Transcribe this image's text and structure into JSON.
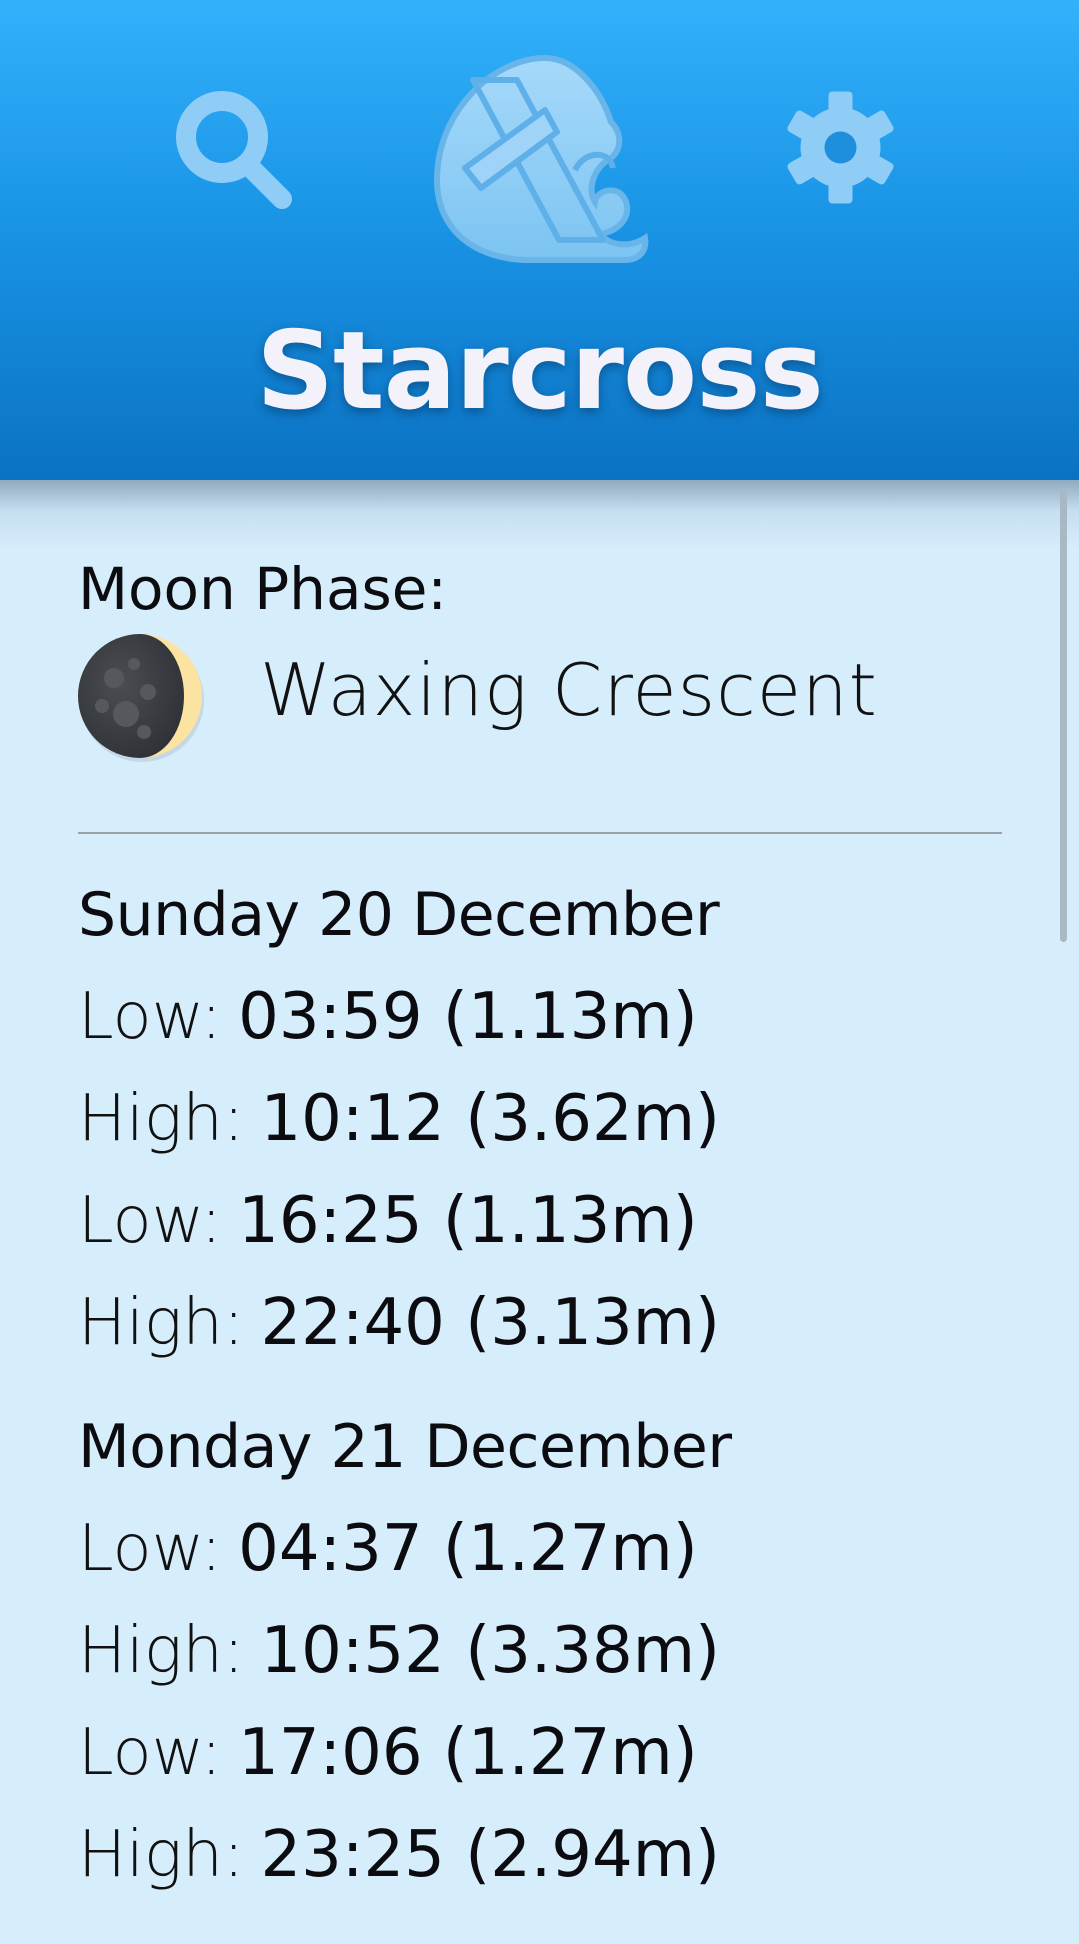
{
  "header": {
    "app_title": "Starcross",
    "search_icon": "search-icon",
    "settings_icon": "gear-icon",
    "logo": "app-logo",
    "colors": {
      "gradient_top": "#33b1fb",
      "gradient_bottom": "#0b72c2",
      "icon": "#8fcdf6",
      "title": "#f3f2fb"
    }
  },
  "moon": {
    "label": "Moon Phase:",
    "phase": "Waxing Crescent",
    "icon": "waxing-crescent-moon-icon"
  },
  "days": [
    {
      "heading": "Sunday 20 December",
      "tides": [
        {
          "type": "Low:",
          "value": "03:59 (1.13m)"
        },
        {
          "type": "High:",
          "value": "10:12 (3.62m)"
        },
        {
          "type": "Low:",
          "value": "16:25 (1.13m)"
        },
        {
          "type": "High:",
          "value": "22:40 (3.13m)"
        }
      ]
    },
    {
      "heading": "Monday 21 December",
      "tides": [
        {
          "type": "Low:",
          "value": "04:37 (1.27m)"
        },
        {
          "type": "High:",
          "value": "10:52 (3.38m)"
        },
        {
          "type": "Low:",
          "value": "17:06 (1.27m)"
        },
        {
          "type": "High:",
          "value": "23:25 (2.94m)"
        }
      ]
    }
  ],
  "background": "#d6edfc"
}
